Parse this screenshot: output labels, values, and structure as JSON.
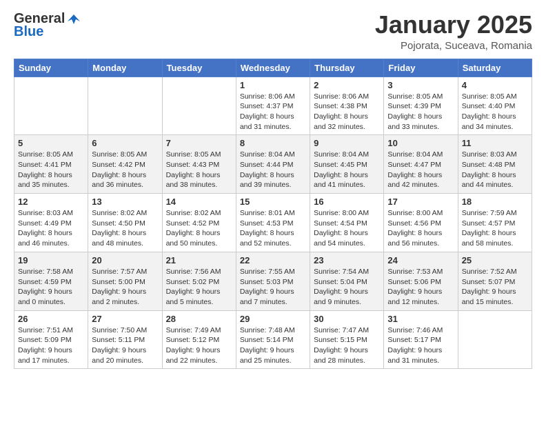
{
  "header": {
    "logo_general": "General",
    "logo_blue": "Blue",
    "month": "January 2025",
    "location": "Pojorata, Suceava, Romania"
  },
  "weekdays": [
    "Sunday",
    "Monday",
    "Tuesday",
    "Wednesday",
    "Thursday",
    "Friday",
    "Saturday"
  ],
  "weeks": [
    [
      {
        "day": "",
        "info": ""
      },
      {
        "day": "",
        "info": ""
      },
      {
        "day": "",
        "info": ""
      },
      {
        "day": "1",
        "info": "Sunrise: 8:06 AM\nSunset: 4:37 PM\nDaylight: 8 hours\nand 31 minutes."
      },
      {
        "day": "2",
        "info": "Sunrise: 8:06 AM\nSunset: 4:38 PM\nDaylight: 8 hours\nand 32 minutes."
      },
      {
        "day": "3",
        "info": "Sunrise: 8:05 AM\nSunset: 4:39 PM\nDaylight: 8 hours\nand 33 minutes."
      },
      {
        "day": "4",
        "info": "Sunrise: 8:05 AM\nSunset: 4:40 PM\nDaylight: 8 hours\nand 34 minutes."
      }
    ],
    [
      {
        "day": "5",
        "info": "Sunrise: 8:05 AM\nSunset: 4:41 PM\nDaylight: 8 hours\nand 35 minutes."
      },
      {
        "day": "6",
        "info": "Sunrise: 8:05 AM\nSunset: 4:42 PM\nDaylight: 8 hours\nand 36 minutes."
      },
      {
        "day": "7",
        "info": "Sunrise: 8:05 AM\nSunset: 4:43 PM\nDaylight: 8 hours\nand 38 minutes."
      },
      {
        "day": "8",
        "info": "Sunrise: 8:04 AM\nSunset: 4:44 PM\nDaylight: 8 hours\nand 39 minutes."
      },
      {
        "day": "9",
        "info": "Sunrise: 8:04 AM\nSunset: 4:45 PM\nDaylight: 8 hours\nand 41 minutes."
      },
      {
        "day": "10",
        "info": "Sunrise: 8:04 AM\nSunset: 4:47 PM\nDaylight: 8 hours\nand 42 minutes."
      },
      {
        "day": "11",
        "info": "Sunrise: 8:03 AM\nSunset: 4:48 PM\nDaylight: 8 hours\nand 44 minutes."
      }
    ],
    [
      {
        "day": "12",
        "info": "Sunrise: 8:03 AM\nSunset: 4:49 PM\nDaylight: 8 hours\nand 46 minutes."
      },
      {
        "day": "13",
        "info": "Sunrise: 8:02 AM\nSunset: 4:50 PM\nDaylight: 8 hours\nand 48 minutes."
      },
      {
        "day": "14",
        "info": "Sunrise: 8:02 AM\nSunset: 4:52 PM\nDaylight: 8 hours\nand 50 minutes."
      },
      {
        "day": "15",
        "info": "Sunrise: 8:01 AM\nSunset: 4:53 PM\nDaylight: 8 hours\nand 52 minutes."
      },
      {
        "day": "16",
        "info": "Sunrise: 8:00 AM\nSunset: 4:54 PM\nDaylight: 8 hours\nand 54 minutes."
      },
      {
        "day": "17",
        "info": "Sunrise: 8:00 AM\nSunset: 4:56 PM\nDaylight: 8 hours\nand 56 minutes."
      },
      {
        "day": "18",
        "info": "Sunrise: 7:59 AM\nSunset: 4:57 PM\nDaylight: 8 hours\nand 58 minutes."
      }
    ],
    [
      {
        "day": "19",
        "info": "Sunrise: 7:58 AM\nSunset: 4:59 PM\nDaylight: 9 hours\nand 0 minutes."
      },
      {
        "day": "20",
        "info": "Sunrise: 7:57 AM\nSunset: 5:00 PM\nDaylight: 9 hours\nand 2 minutes."
      },
      {
        "day": "21",
        "info": "Sunrise: 7:56 AM\nSunset: 5:02 PM\nDaylight: 9 hours\nand 5 minutes."
      },
      {
        "day": "22",
        "info": "Sunrise: 7:55 AM\nSunset: 5:03 PM\nDaylight: 9 hours\nand 7 minutes."
      },
      {
        "day": "23",
        "info": "Sunrise: 7:54 AM\nSunset: 5:04 PM\nDaylight: 9 hours\nand 9 minutes."
      },
      {
        "day": "24",
        "info": "Sunrise: 7:53 AM\nSunset: 5:06 PM\nDaylight: 9 hours\nand 12 minutes."
      },
      {
        "day": "25",
        "info": "Sunrise: 7:52 AM\nSunset: 5:07 PM\nDaylight: 9 hours\nand 15 minutes."
      }
    ],
    [
      {
        "day": "26",
        "info": "Sunrise: 7:51 AM\nSunset: 5:09 PM\nDaylight: 9 hours\nand 17 minutes."
      },
      {
        "day": "27",
        "info": "Sunrise: 7:50 AM\nSunset: 5:11 PM\nDaylight: 9 hours\nand 20 minutes."
      },
      {
        "day": "28",
        "info": "Sunrise: 7:49 AM\nSunset: 5:12 PM\nDaylight: 9 hours\nand 22 minutes."
      },
      {
        "day": "29",
        "info": "Sunrise: 7:48 AM\nSunset: 5:14 PM\nDaylight: 9 hours\nand 25 minutes."
      },
      {
        "day": "30",
        "info": "Sunrise: 7:47 AM\nSunset: 5:15 PM\nDaylight: 9 hours\nand 28 minutes."
      },
      {
        "day": "31",
        "info": "Sunrise: 7:46 AM\nSunset: 5:17 PM\nDaylight: 9 hours\nand 31 minutes."
      },
      {
        "day": "",
        "info": ""
      }
    ]
  ]
}
